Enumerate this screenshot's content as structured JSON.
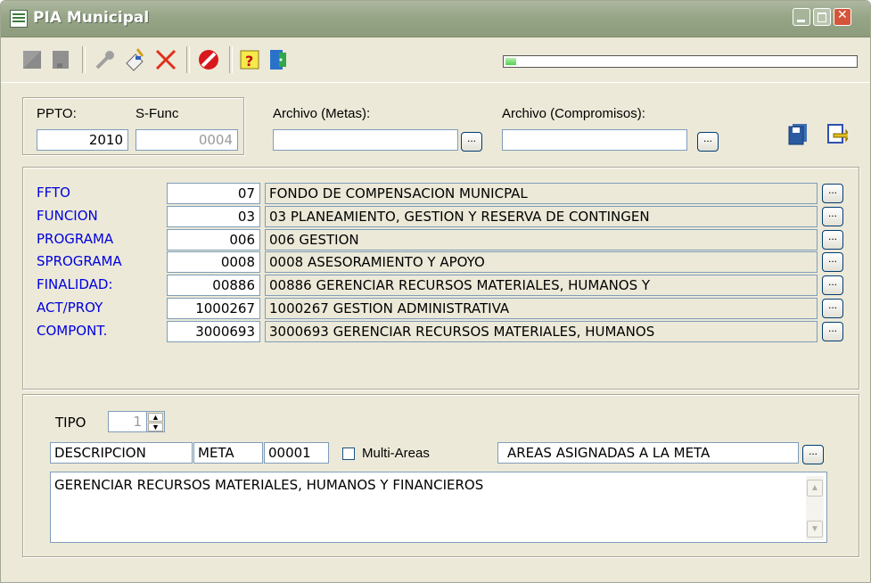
{
  "window": {
    "title": "PIA Municipal"
  },
  "toolbar": {
    "icons": [
      "new-icon",
      "save-icon",
      "key-icon",
      "edit-icon",
      "delete-icon",
      "stop-icon",
      "help-icon",
      "exit-icon"
    ],
    "progress_fraction": 0.03,
    "progress_color": "#4fd150"
  },
  "header": {
    "ppto_label": "PPTO:",
    "ppto_value": "2010",
    "sfunc_label": "S-Func",
    "sfunc_value": "0004",
    "metas_label": "Archivo (Metas):",
    "metas_value": "",
    "compromisos_label": "Archivo (Compromisos):",
    "compromisos_value": "",
    "browse_label": "..."
  },
  "classifiers": [
    {
      "label": "FFTO",
      "code": "07",
      "description": "FONDO DE COMPENSACION MUNICPAL"
    },
    {
      "label": "FUNCION",
      "code": "03",
      "description": "03 PLANEAMIENTO, GESTION Y RESERVA DE CONTINGEN"
    },
    {
      "label": "PROGRAMA",
      "code": "006",
      "description": "006 GESTION"
    },
    {
      "label": "SPROGRAMA",
      "code": "0008",
      "description": "0008 ASESORAMIENTO Y APOYO"
    },
    {
      "label": "FINALIDAD:",
      "code": "00886",
      "description": "00886 GERENCIAR RECURSOS MATERIALES, HUMANOS Y"
    },
    {
      "label": "ACT/PROY",
      "code": "1000267",
      "description": "1000267 GESTION ADMINISTRATIVA"
    },
    {
      "label": "COMPONT.",
      "code": "3000693",
      "description": "3000693 GERENCIAR RECURSOS MATERIALES, HUMANOS"
    }
  ],
  "meta": {
    "tipo_label": "TIPO",
    "tipo_value": "1",
    "descripcion_label": "DESCRIPCION",
    "meta_label": "META",
    "meta_code": "00001",
    "multi_areas_label": "Multi-Areas",
    "multi_areas_checked": false,
    "areas_label": "AREAS ASIGNADAS A LA META",
    "description_text": "GERENCIAR RECURSOS MATERIALES, HUMANOS Y FINANCIEROS"
  },
  "colors": {
    "label_blue": "#0000dd",
    "close_red": "#d4553a",
    "titlebar": "#97a587"
  }
}
